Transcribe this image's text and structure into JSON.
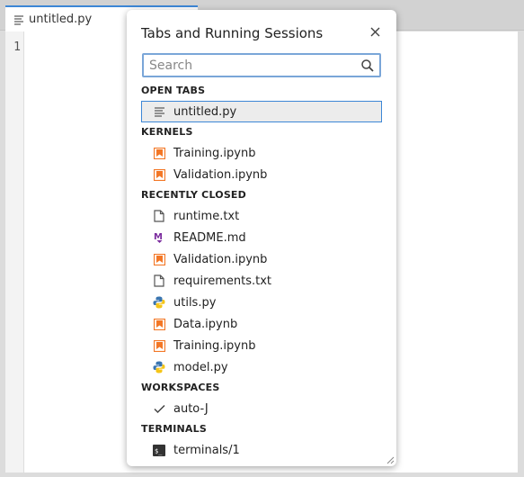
{
  "editor": {
    "tab_label": "untitled.py",
    "line_numbers": [
      "1"
    ]
  },
  "modal": {
    "title": "Tabs and Running Sessions",
    "search_placeholder": "Search",
    "sections": {
      "open_tabs": {
        "label": "OPEN TABS",
        "items": [
          {
            "label": "untitled.py",
            "icon": "text-file-icon",
            "active": true
          }
        ]
      },
      "kernels": {
        "label": "KERNELS",
        "items": [
          {
            "label": "Training.ipynb",
            "icon": "notebook-icon"
          },
          {
            "label": "Validation.ipynb",
            "icon": "notebook-icon"
          }
        ]
      },
      "recently_closed": {
        "label": "RECENTLY CLOSED",
        "items": [
          {
            "label": "runtime.txt",
            "icon": "file-icon"
          },
          {
            "label": "README.md",
            "icon": "markdown-icon"
          },
          {
            "label": "Validation.ipynb",
            "icon": "notebook-icon"
          },
          {
            "label": "requirements.txt",
            "icon": "file-icon"
          },
          {
            "label": "utils.py",
            "icon": "python-icon"
          },
          {
            "label": "Data.ipynb",
            "icon": "notebook-icon"
          },
          {
            "label": "Training.ipynb",
            "icon": "notebook-icon"
          },
          {
            "label": "model.py",
            "icon": "python-icon"
          }
        ]
      },
      "workspaces": {
        "label": "WORKSPACES",
        "items": [
          {
            "label": "auto-J",
            "icon": "check-icon"
          }
        ]
      },
      "terminals": {
        "label": "TERMINALS",
        "items": [
          {
            "label": "terminals/1",
            "icon": "terminal-icon"
          }
        ]
      }
    }
  },
  "colors": {
    "accent": "#3d87d6",
    "notebook": "#f37726",
    "markdown": "#7b2c9e"
  }
}
